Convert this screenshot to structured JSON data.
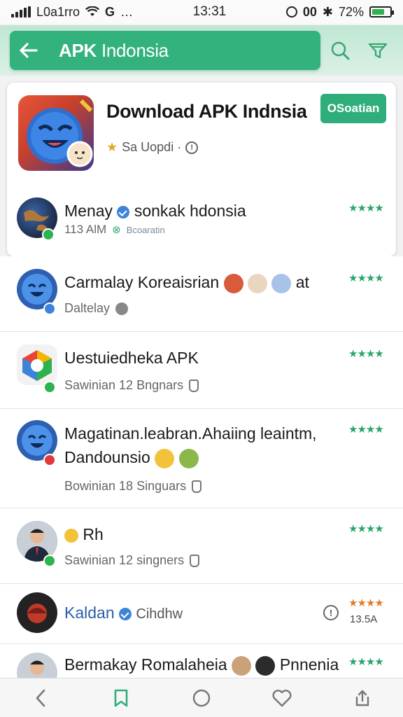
{
  "status": {
    "carrier": "L0a1rro",
    "time": "13:31",
    "indicators": "00",
    "battery": "72%",
    "battery_level": 0.72
  },
  "header": {
    "back_icon": "arrow-left-icon",
    "title_bold": "APK",
    "title_rest": "Indonsia",
    "search_icon": "search-icon",
    "filter_icon": "filter-icon"
  },
  "featured": {
    "title": "Download APK Indnsia",
    "rating_text": "Sa Uopdi ·",
    "install_label": "OSoatian"
  },
  "items": [
    {
      "title": "Menay",
      "title_rest": "sonkak hdonsia",
      "sub": "113 AlM",
      "sub_extra": "Bcoaratin",
      "stars": "★★★★"
    },
    {
      "title": "Carmalay Koreaisrian",
      "title_rest": "at",
      "sub": "Daltelay",
      "stars": "★★★★"
    },
    {
      "title": "Uestuiedheka APK",
      "sub": "Sawinian 12 Bngnars",
      "stars": "★★★★"
    },
    {
      "title": "Magatinan.leabran.Ahaiing leaintm,",
      "title_line2": "Dandounsio",
      "sub": "Bowinian 18 Singuars",
      "stars": "★★★★"
    },
    {
      "title": "Rh",
      "sub": "Sawinian 12 singners",
      "stars": "★★★★"
    },
    {
      "title": "Kaldan",
      "title_rest": "Cihdhw",
      "sub": "",
      "stars": "★★★★",
      "meta": "13.5A"
    },
    {
      "title": "Bermakay Romalaheia",
      "title_rest": "Pnnenia",
      "stars": "★★★★"
    }
  ],
  "colors": {
    "accent": "#33b27d",
    "star_green": "#27a66b",
    "star_orange": "#e07b2a"
  }
}
